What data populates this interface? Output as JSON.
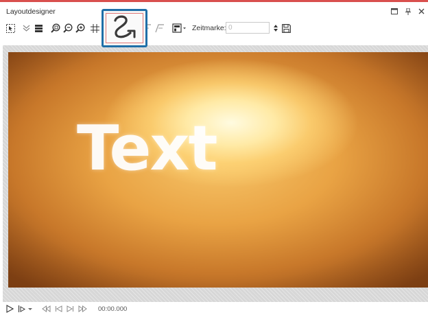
{
  "window": {
    "title": "Layoutdesigner",
    "controls": [
      "restore-icon",
      "pin-icon",
      "close-icon"
    ]
  },
  "toolbar": {
    "tools": [
      "select-object-icon",
      "chevron-double-down-icon",
      "layers-icon",
      "zoom-fit-icon",
      "zoom-out-icon",
      "zoom-in-icon",
      "grid-icon",
      "motion-path-icon",
      "keyframe-add-icon",
      "keyframe-remove-icon",
      "template-dropdown-icon"
    ],
    "zeitmarke_label": "Zeitmarke:",
    "zeitmarke_value": "0",
    "save_icon": "save-icon"
  },
  "stage": {
    "text": "Text"
  },
  "playback": {
    "timecode": "00:00.000"
  },
  "colors": {
    "accent_top": "#d9504e",
    "highlight_border": "#1f6fa8"
  }
}
